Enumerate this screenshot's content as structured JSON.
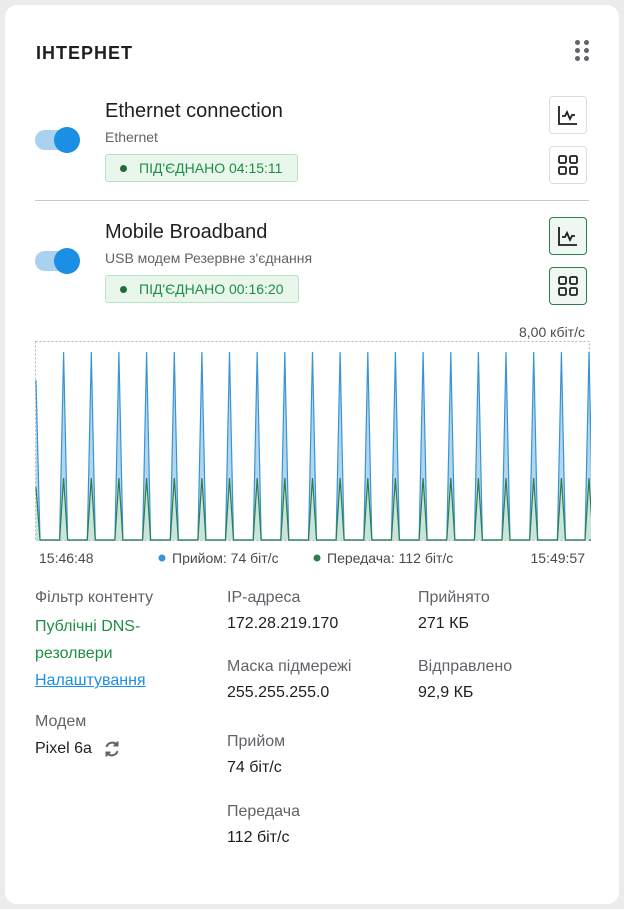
{
  "title": "ІНТЕРНЕТ",
  "connections": [
    {
      "name": "Ethernet connection",
      "subtitle": "Ethernet",
      "status": "ПІД'ЄДНАНО 04:15:11",
      "enabled": true
    },
    {
      "name": "Mobile Broadband",
      "subtitle": "USB модем Резервне з'єднання",
      "status": "ПІД'ЄДНАНО 00:16:20",
      "enabled": true
    }
  ],
  "chart_data": {
    "type": "area",
    "y_max_label": "8,00 кбіт/с",
    "ylim": [
      0,
      8
    ],
    "x_start_label": "15:46:48",
    "x_end_label": "15:49:57",
    "legend": [
      "Прийом: 74 біт/с",
      "Передача: 112 біт/с"
    ],
    "series": [
      {
        "name": "Прийом",
        "color": "#3a94d4",
        "fill": "#a9d3ee",
        "peak": 7.6,
        "count": 21
      },
      {
        "name": "Передача",
        "color": "#2e7d4f",
        "fill": "#cfe7d8",
        "peak": 2.5,
        "count": 21
      }
    ]
  },
  "info": {
    "filter_label": "Фільтр контенту",
    "filter_value_1": "Публічні DNS-",
    "filter_value_2": "резолвери",
    "filter_link": "Налаштування",
    "modem_label": "Модем",
    "modem_value": "Pixel 6a",
    "ip_label": "IP-адреса",
    "ip_value": "172.28.219.170",
    "mask_label": "Маска підмережі",
    "mask_value": "255.255.255.0",
    "rx_label": "Прийом",
    "rx_value": "74 біт/с",
    "tx_label": "Передача",
    "tx_value": "112 біт/с",
    "received_label": "Прийнято",
    "received_value": "271 КБ",
    "sent_label": "Відправлено",
    "sent_value": "92,9 КБ"
  }
}
